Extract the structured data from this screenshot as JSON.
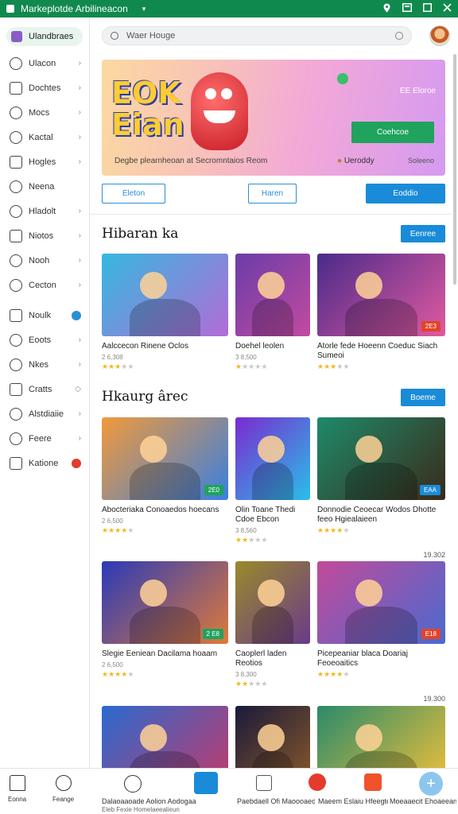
{
  "window": {
    "title": "Markeplotde Arbilineacon",
    "dropdown_glyph": "▾"
  },
  "titlebar_icons": [
    "location-icon",
    "window-icon",
    "maximize-icon",
    "close-icon"
  ],
  "sidebar": {
    "top_label": "Ulandbraes",
    "items": [
      {
        "label": "Ulacon",
        "icon": "globe-icon",
        "marker": "›"
      },
      {
        "label": "Dochtes",
        "icon": "apps-icon",
        "marker": "›"
      },
      {
        "label": "Mocs",
        "icon": "chat-icon",
        "marker": "›"
      },
      {
        "label": "Kactal",
        "icon": "compass-icon",
        "marker": "›"
      },
      {
        "label": "Hogles",
        "icon": "document-icon",
        "marker": "›"
      },
      {
        "label": "Neena",
        "icon": "music-icon",
        "marker": ""
      },
      {
        "label": "Hladolt",
        "icon": "shop-icon",
        "marker": "›"
      },
      {
        "label": "Niotos",
        "icon": "video-icon",
        "marker": "›"
      },
      {
        "label": "Nooh",
        "icon": "comment-icon",
        "marker": "›"
      },
      {
        "label": "Cecton",
        "icon": "emoji-icon",
        "marker": "›"
      },
      {
        "label": "Noulk",
        "icon": "gamepad-icon",
        "marker": "dot-blue"
      },
      {
        "label": "Eoots",
        "icon": "list-icon",
        "marker": "›"
      },
      {
        "label": "Nkes",
        "icon": "people-icon",
        "marker": "›"
      },
      {
        "label": "Cratts",
        "icon": "puzzle-icon",
        "marker": "◇"
      },
      {
        "label": "Alstdiaiie",
        "icon": "photo-icon",
        "marker": "›"
      },
      {
        "label": "Feere",
        "icon": "folder-icon",
        "marker": "›"
      },
      {
        "label": "Katione",
        "icon": "shield-icon",
        "marker": "dot-red"
      }
    ]
  },
  "header": {
    "search_placeholder": "Waer Houge"
  },
  "banner": {
    "logo_line1": "EOK",
    "logo_line2": "Eian",
    "tag": "EE Eloroe",
    "button": "Coehcoe",
    "description": "Degbe plearnheoan at Secromntaios Reom",
    "rating": "Ueroddy",
    "count": "Soleeno",
    "tabs": [
      "Eleton",
      "Haren",
      "Eoddio"
    ]
  },
  "sections": [
    {
      "title": "Hibaran ka",
      "more_label": "Eenree",
      "cards": [
        {
          "name": "Aalccecon Rinene Oclos",
          "meta": "2 6,308",
          "rating": 3,
          "badge": "",
          "count": "",
          "colors": [
            "#35b8e0",
            "#b36cd6"
          ]
        },
        {
          "name": "Doehel leolen",
          "meta": "3 8,500",
          "rating": 1,
          "badge": "",
          "count": "",
          "colors": [
            "#6a3da8",
            "#c24aa0"
          ]
        },
        {
          "name": "Atorle fede Hoeenn Coeduc Siach Sumeoi",
          "meta": "",
          "rating": 3,
          "badge": "2E3",
          "count": "",
          "colors": [
            "#4a2a8a",
            "#e05aa0"
          ]
        }
      ]
    },
    {
      "title": "Hkaurg ârec",
      "more_label": "Boeme",
      "cards": [
        {
          "name": "Abocteriaka Conoaedos hoecans",
          "meta": "2 6,500",
          "rating": 4,
          "badge": "2E0",
          "count": "",
          "colors": [
            "#f29a3a",
            "#3a7fe0"
          ]
        },
        {
          "name": "Olin Toane Thedi Cdoe Ebcon",
          "meta": "3 8,560",
          "rating": 2,
          "badge": "",
          "count": "",
          "colors": [
            "#7a2ad0",
            "#2abfe8"
          ]
        },
        {
          "name": "Donnodie Ceoecar Wodos Dhotte feeo Hgiealaieen",
          "meta": "",
          "rating": 4,
          "badge": "EAA",
          "count": "19.302",
          "colors": [
            "#1e8a6a",
            "#3a2a1a"
          ]
        },
        {
          "name": "Slegie Eeniean Dacilama hoaam",
          "meta": "2 6,500",
          "rating": 4,
          "badge": "2 E8",
          "count": "",
          "colors": [
            "#2a3ab8",
            "#e07a3a"
          ]
        },
        {
          "name": "Caoplerl laden Reotios",
          "meta": "3 8,300",
          "rating": 2,
          "badge": "",
          "count": "",
          "colors": [
            "#9a8a2a",
            "#6a3a8a"
          ]
        },
        {
          "name": "Picepeaniar blaca Doariaj Feoeoaitics",
          "meta": "",
          "rating": 4,
          "badge": "E18",
          "count": "19.300",
          "colors": [
            "#c24a9a",
            "#4a6ad0"
          ]
        }
      ]
    },
    {
      "cards": [
        {
          "colors": [
            "#2a6ad0",
            "#c23a6a"
          ]
        },
        {
          "colors": [
            "#1a1a3a",
            "#8a5a2a"
          ]
        },
        {
          "colors": [
            "#2a8a6a",
            "#f0c03a"
          ]
        }
      ]
    }
  ],
  "bottombar": {
    "left_labels": [
      "Eonna",
      "Feange"
    ],
    "captions": [
      "Dalaoaaoade Aolion Aodogaa",
      "Eleb Fexie Homelaeealieun",
      "Paebdaell Ofi Maoooaediea",
      "Maeem Eslaiu Hfeegtenie",
      "Moeaaecit Ehoaeeanaoaa"
    ]
  },
  "colors": {
    "accent": "#1a8bd8",
    "titlebar": "#10894e",
    "banner_button": "#1fa35d",
    "star": "#f2b820"
  }
}
